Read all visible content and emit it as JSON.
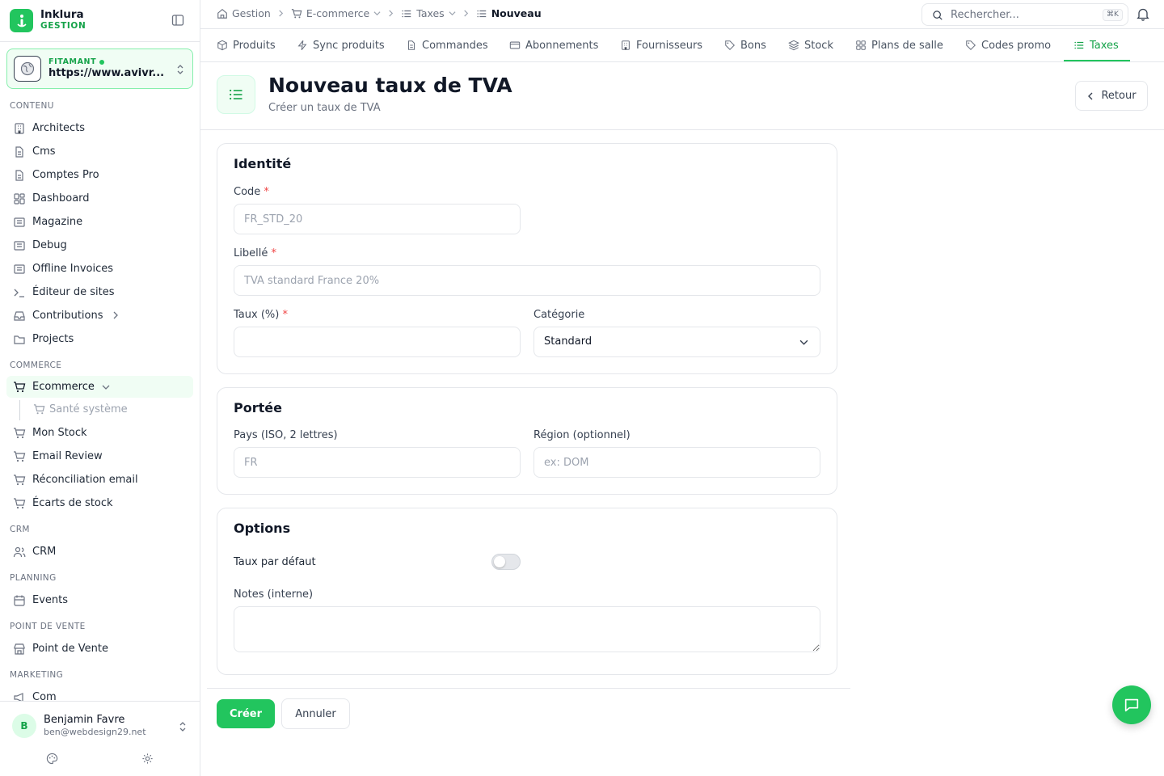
{
  "brand": {
    "name": "Inklura",
    "subtitle": "GESTION"
  },
  "site": {
    "tag": "FITAMANT",
    "url": "https://www.avivr..."
  },
  "sidebar": {
    "sections": {
      "contenu": "CONTENU",
      "commerce": "COMMERCE",
      "crm": "CRM",
      "planning": "PLANNING",
      "pos": "POINT DE VENTE",
      "marketing": "MARKETING"
    },
    "items": {
      "architects": "Architects",
      "cms": "Cms",
      "comptes_pro": "Comptes Pro",
      "dashboard": "Dashboard",
      "magazine": "Magazine",
      "debug": "Debug",
      "offline_invoices": "Offline Invoices",
      "editeur": "Éditeur de sites",
      "contributions": "Contributions",
      "projects": "Projects",
      "ecommerce": "Ecommerce",
      "sante": "Santé système",
      "mon_stock": "Mon Stock",
      "email_review": "Email Review",
      "reconciliation": "Réconciliation email",
      "ecarts": "Écarts de stock",
      "crm": "CRM",
      "events": "Events",
      "point_de_vente": "Point de Vente",
      "com": "Com"
    }
  },
  "user": {
    "name": "Benjamin Favre",
    "email": "ben@webdesign29.net",
    "initial": "B"
  },
  "breadcrumb": [
    "Gestion",
    "E-commerce",
    "Taxes",
    "Nouveau"
  ],
  "search": {
    "placeholder": "Rechercher...",
    "shortcut": "⌘K"
  },
  "tabs": [
    "Produits",
    "Sync produits",
    "Commandes",
    "Abonnements",
    "Fournisseurs",
    "Bons",
    "Stock",
    "Plans de salle",
    "Codes promo",
    "Taxes"
  ],
  "active_tab": "Taxes",
  "header": {
    "title": "Nouveau taux de TVA",
    "subtitle": "Créer un taux de TVA",
    "back_label": "Retour"
  },
  "form": {
    "identite": {
      "title": "Identité",
      "code_label": "Code",
      "code_placeholder": "FR_STD_20",
      "libelle_label": "Libellé",
      "libelle_placeholder": "TVA standard France 20%",
      "taux_label": "Taux (%)",
      "taux_value": "",
      "categorie_label": "Catégorie",
      "categorie_value": "Standard"
    },
    "portee": {
      "title": "Portée",
      "pays_label": "Pays (ISO, 2 lettres)",
      "pays_placeholder": "FR",
      "region_label": "Région (optionnel)",
      "region_placeholder": "ex: DOM"
    },
    "options": {
      "title": "Options",
      "default_label": "Taux par défaut",
      "default_on": false,
      "notes_label": "Notes (interne)",
      "notes_value": ""
    },
    "required_mark": "*"
  },
  "actions": {
    "create": "Créer",
    "cancel": "Annuler"
  },
  "colors": {
    "accent": "#22c55e",
    "accent_dark": "#16a34a",
    "required": "#ef4444"
  }
}
